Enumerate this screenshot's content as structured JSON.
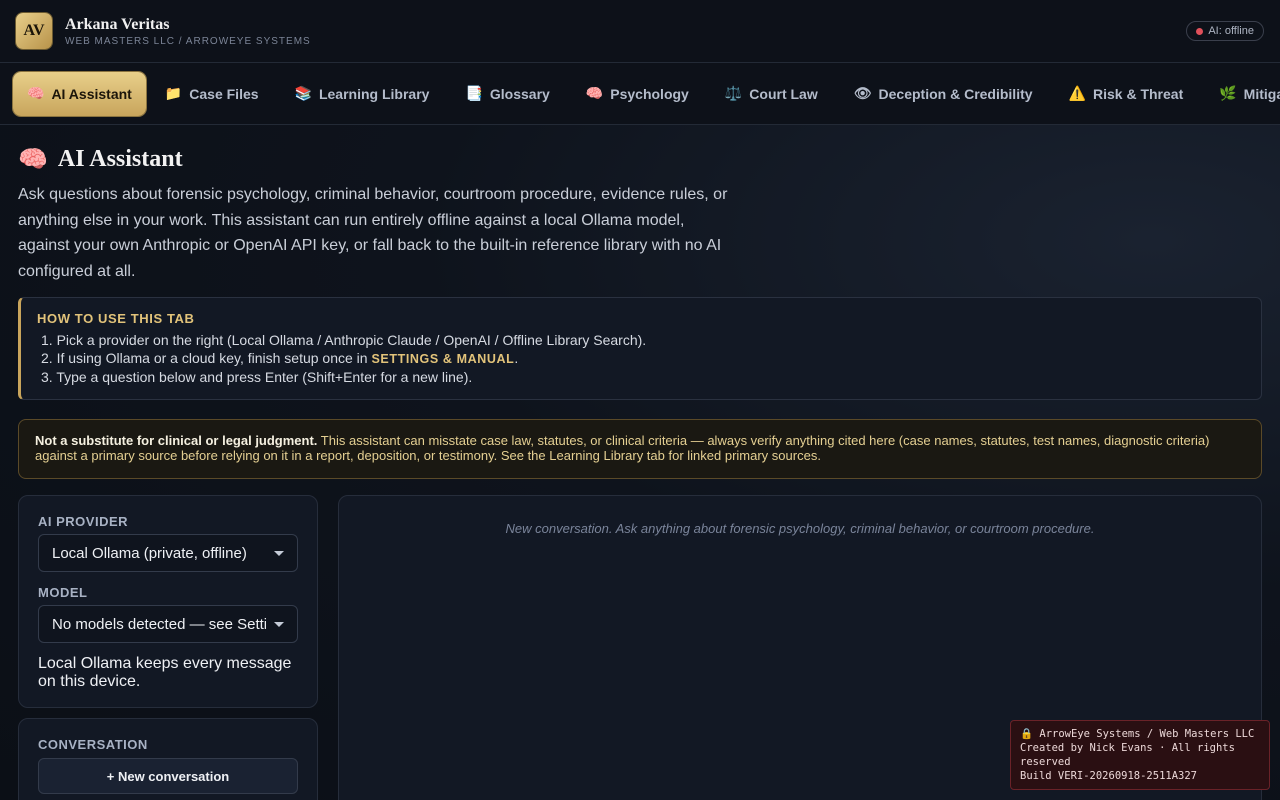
{
  "header": {
    "logo_text": "AV",
    "app_name": "Arkana Veritas",
    "subtitle": "WEB MASTERS LLC / ARROWEYE SYSTEMS",
    "status_label": "AI: offline",
    "status_color": "#e0505a"
  },
  "tabs": [
    {
      "icon": "🧠",
      "label": "AI Assistant",
      "active": true
    },
    {
      "icon": "📁",
      "label": "Case Files"
    },
    {
      "icon": "📚",
      "label": "Learning Library"
    },
    {
      "icon": "📑",
      "label": "Glossary"
    },
    {
      "icon": "🧠",
      "label": "Psychology"
    },
    {
      "icon": "⚖️",
      "label": "Court Law"
    },
    {
      "icon": "👁",
      "label": "Deception & Credibility"
    },
    {
      "icon": "⚠️",
      "label": "Risk & Threat"
    },
    {
      "icon": "🌿",
      "label": "Mitigation"
    }
  ],
  "page": {
    "title_icon": "🧠",
    "title": "AI Assistant",
    "intro": "Ask questions about forensic psychology, criminal behavior, courtroom procedure, evidence rules, or anything else in your work. This assistant can run entirely offline against a local Ollama model, against your own Anthropic or OpenAI API key, or fall back to the built-in reference library with no AI configured at all."
  },
  "howto": {
    "title": "HOW TO USE THIS TAB",
    "step1": "1. Pick a provider on the right (Local Ollama / Anthropic Claude / OpenAI / Offline Library Search).",
    "step2_pre": "2. If using Ollama or a cloud key, finish setup once in ",
    "step2_link": "SETTINGS & MANUAL",
    "step2_post": ".",
    "step3": "3. Type a question below and press Enter (Shift+Enter for a new line)."
  },
  "warning": {
    "bold": "Not a substitute for clinical or legal judgment.",
    "text": " This assistant can misstate case law, statutes, or clinical criteria — always verify anything cited here (case names, statutes, test names, diagnostic criteria) against a primary source before relying on it in a report, deposition, or testimony. See the Learning Library tab for linked primary sources."
  },
  "provider": {
    "label": "AI PROVIDER",
    "selected": "Local Ollama (private, offline)",
    "model_label": "MODEL",
    "model_selected": "No models detected — see Settings",
    "note": "Local Ollama keeps every message on this device."
  },
  "conversation": {
    "label": "CONVERSATION",
    "new_button": "+ New conversation"
  },
  "chat": {
    "empty_text": "New conversation. Ask anything about forensic psychology, criminal behavior, or courtroom procedure."
  },
  "footer": {
    "line1": "🔒 ArrowEye Systems / Web Masters LLC",
    "line2": "Created by Nick Evans · All rights reserved",
    "line3": "Build VERI-20260918-2511A327"
  }
}
